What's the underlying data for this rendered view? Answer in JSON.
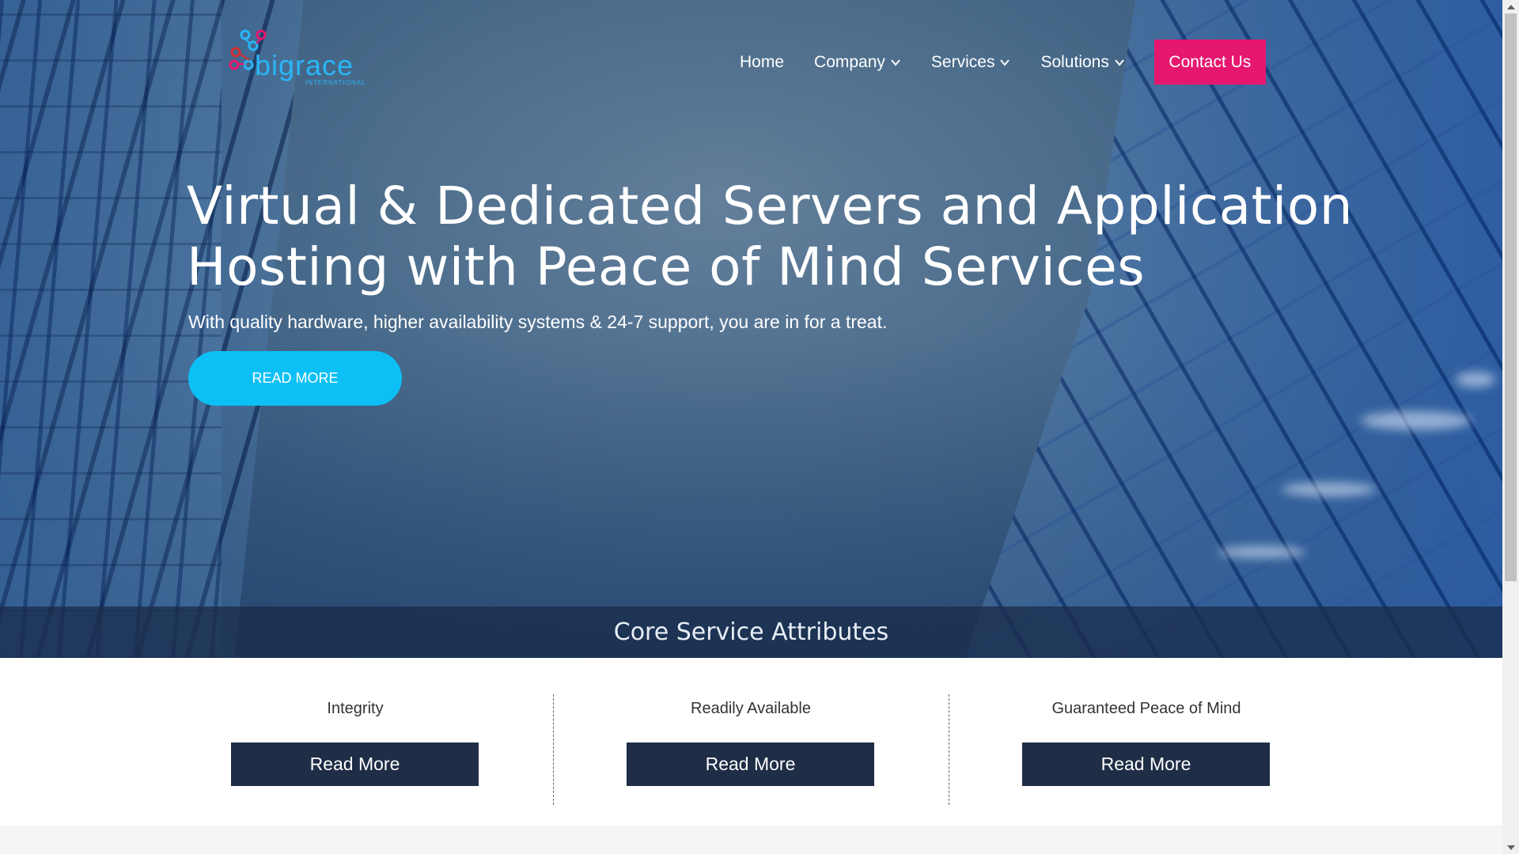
{
  "brand": {
    "name": "bigrace",
    "subtitle": "INTERNATIONAL",
    "colors": {
      "blue": "#29b6f6",
      "magenta": "#e5176f",
      "red": "#d32f2f"
    }
  },
  "nav": {
    "items": [
      {
        "label": "Home",
        "dropdown": false
      },
      {
        "label": "Company",
        "dropdown": true
      },
      {
        "label": "Services",
        "dropdown": true
      },
      {
        "label": "Solutions",
        "dropdown": true
      }
    ],
    "cta": "Contact Us"
  },
  "hero": {
    "title_line1": "Virtual & Dedicated Servers and Application",
    "title_line2": "Hosting with Peace of Mind Services",
    "subtitle": "With quality hardware, higher availability systems & 24-7 support, you are in for a treat.",
    "button": "READ MORE"
  },
  "attributes": {
    "heading": "Core Service Attributes",
    "items": [
      {
        "label": "Integrity",
        "button": "Read More"
      },
      {
        "label": "Readily Available",
        "button": "Read More"
      },
      {
        "label": "Guaranteed Peace of Mind",
        "button": "Read More"
      }
    ]
  },
  "theme": {
    "cta_color": "#e5176f",
    "hero_button_color": "#0cc0f5",
    "feature_button_color": "#1f2d46"
  },
  "icons": {
    "chevron": "chevron-down-icon",
    "scroll_up": "scroll-up-arrow-icon",
    "scroll_down": "scroll-down-arrow-icon"
  }
}
